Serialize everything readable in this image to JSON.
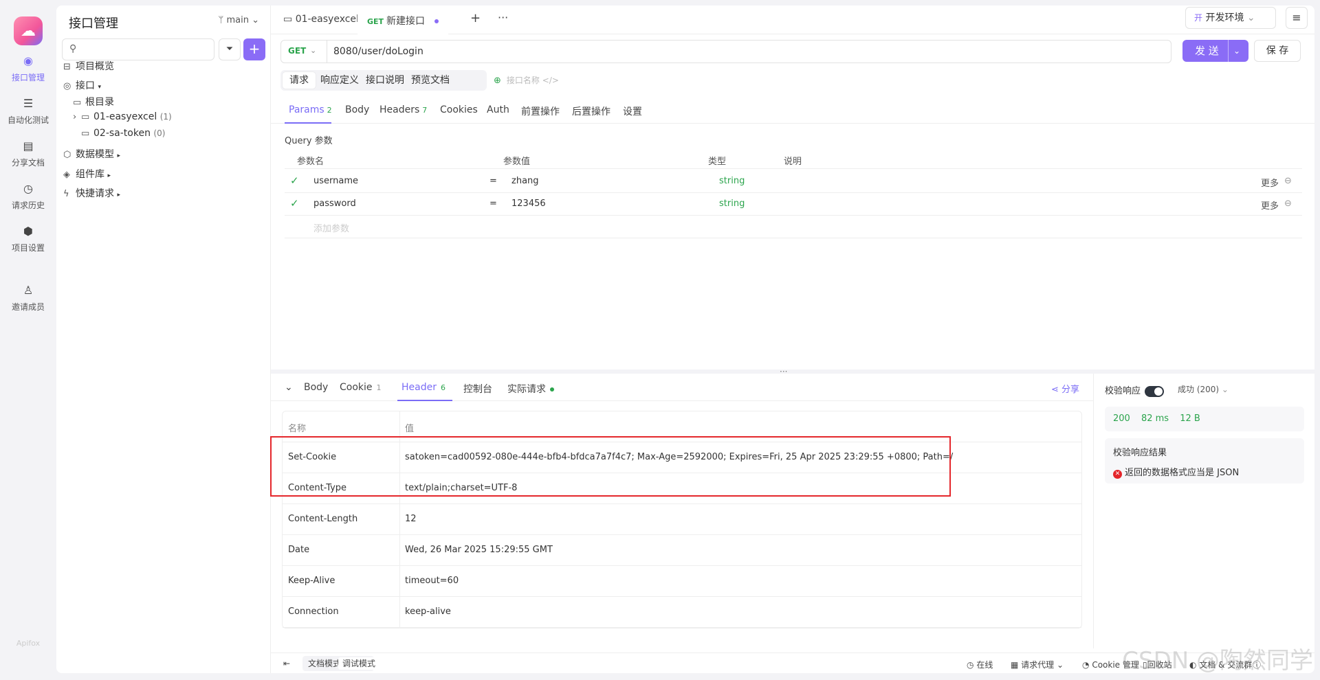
{
  "rail": {
    "items": [
      {
        "label": "接口管理",
        "icon": "api-icon"
      },
      {
        "label": "自动化测试",
        "icon": "automation-icon"
      },
      {
        "label": "分享文档",
        "icon": "book-icon"
      },
      {
        "label": "请求历史",
        "icon": "history-icon"
      },
      {
        "label": "项目设置",
        "icon": "settings-icon"
      },
      {
        "label": "邀请成员",
        "icon": "invite-icon"
      }
    ],
    "footer": "Apifox"
  },
  "sidebar": {
    "title": "接口管理",
    "branch": "main",
    "tree": [
      {
        "label": "项目概览"
      },
      {
        "label": "接口"
      },
      {
        "label": "根目录"
      },
      {
        "label": "01-easyexcel",
        "count": "(1)"
      },
      {
        "label": "02-sa-token",
        "count": "(0)"
      },
      {
        "label": "数据模型"
      },
      {
        "label": "组件库"
      },
      {
        "label": "快捷请求"
      }
    ]
  },
  "tabs": {
    "folder_tab": "01-easyexcel",
    "active_method": "GET",
    "active_tab": "新建接口",
    "env": "开发环境"
  },
  "request": {
    "method": "GET",
    "url": "8080/user/doLogin",
    "send_label": "发 送",
    "save_label": "保 存",
    "subtabs": [
      "请求",
      "响应定义",
      "接口说明",
      "预览文档"
    ],
    "api_name_placeholder": "接口名称"
  },
  "params_tabs": {
    "items": [
      {
        "label": "Params",
        "count": "2"
      },
      {
        "label": "Body"
      },
      {
        "label": "Headers",
        "count": "7"
      },
      {
        "label": "Cookies"
      },
      {
        "label": "Auth"
      },
      {
        "label": "前置操作"
      },
      {
        "label": "后置操作"
      },
      {
        "label": "设置"
      }
    ]
  },
  "query": {
    "label": "Query 参数",
    "headers": [
      "参数名",
      "参数值",
      "类型",
      "说明"
    ],
    "rows": [
      {
        "name": "username",
        "eq": "=",
        "value": "zhang",
        "type": "string",
        "more": "更多"
      },
      {
        "name": "password",
        "eq": "=",
        "value": "123456",
        "type": "string",
        "more": "更多"
      }
    ],
    "add_placeholder": "添加参数"
  },
  "response": {
    "tabs": [
      {
        "label": "Body"
      },
      {
        "label": "Cookie",
        "count": "1"
      },
      {
        "label": "Header",
        "count": "6"
      },
      {
        "label": "控制台"
      },
      {
        "label": "实际请求"
      }
    ],
    "share": "分享",
    "headers_table": {
      "columns": [
        "名称",
        "值"
      ],
      "rows": [
        {
          "k": "Set-Cookie",
          "v": "satoken=cad00592-080e-444e-bfb4-bfdca7a7f4c7; Max-Age=2592000; Expires=Fri, 25 Apr 2025 23:29:55 +0800; Path=/"
        },
        {
          "k": "Content-Type",
          "v": "text/plain;charset=UTF-8"
        },
        {
          "k": "Content-Length",
          "v": "12"
        },
        {
          "k": "Date",
          "v": "Wed, 26 Mar 2025 15:29:55 GMT"
        },
        {
          "k": "Keep-Alive",
          "v": "timeout=60"
        },
        {
          "k": "Connection",
          "v": "keep-alive"
        }
      ]
    }
  },
  "validation": {
    "title": "校验响应",
    "status": "成功 (200)",
    "code": "200",
    "time": "82 ms",
    "size": "12 B",
    "result_title": "校验响应结果",
    "error": "返回的数据格式应当是 JSON"
  },
  "statusbar": {
    "modes": [
      "文档模式",
      "调试模式"
    ],
    "online": "在线",
    "proxy": "请求代理",
    "cookie": "Cookie 管理",
    "recycle": "回收站",
    "docs": "文档 & 交流群"
  },
  "watermark": "CSDN @陶然同学"
}
